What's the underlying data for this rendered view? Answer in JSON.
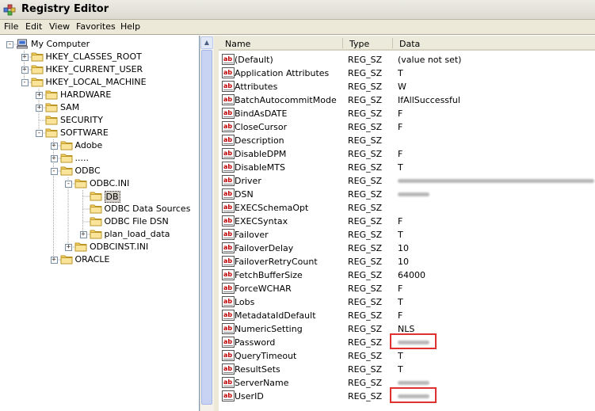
{
  "window": {
    "title": "Registry Editor"
  },
  "menu": [
    "File",
    "Edit",
    "View",
    "Favorites",
    "Help"
  ],
  "tree": [
    {
      "label": "My Computer",
      "level": 0,
      "expander": "-",
      "icon": "computer-icon"
    },
    {
      "label": "HKEY_CLASSES_ROOT",
      "level": 1,
      "expander": "+"
    },
    {
      "label": "HKEY_CURRENT_USER",
      "level": 1,
      "expander": "+"
    },
    {
      "label": "HKEY_LOCAL_MACHINE",
      "level": 1,
      "expander": "-"
    },
    {
      "label": "HARDWARE",
      "level": 2,
      "expander": "+"
    },
    {
      "label": "SAM",
      "level": 2,
      "expander": "+"
    },
    {
      "label": "SECURITY",
      "level": 2,
      "expander": ""
    },
    {
      "label": "SOFTWARE",
      "level": 2,
      "expander": "-"
    },
    {
      "label": "Adobe",
      "level": 3,
      "expander": "+"
    },
    {
      "label": ".....",
      "level": 3,
      "expander": "+"
    },
    {
      "label": "ODBC",
      "level": 3,
      "expander": "-"
    },
    {
      "label": "ODBC.INI",
      "level": 4,
      "expander": "-"
    },
    {
      "label": "DB",
      "level": 5,
      "expander": "",
      "selected": true
    },
    {
      "label": "ODBC Data Sources",
      "level": 5,
      "expander": ""
    },
    {
      "label": "ODBC File DSN",
      "level": 5,
      "expander": ""
    },
    {
      "label": "plan_load_data",
      "level": 5,
      "expander": "+"
    },
    {
      "label": "ODBCINST.INI",
      "level": 4,
      "expander": "+"
    },
    {
      "label": "ORACLE",
      "level": 3,
      "expander": "+"
    }
  ],
  "columns": {
    "name": "Name",
    "type": "Type",
    "data": "Data"
  },
  "values": [
    {
      "name": "(Default)",
      "type": "REG_SZ",
      "data": "(value not set)"
    },
    {
      "name": "Application Attributes",
      "type": "REG_SZ",
      "data": "T"
    },
    {
      "name": "Attributes",
      "type": "REG_SZ",
      "data": "W"
    },
    {
      "name": "BatchAutocommitMode",
      "type": "REG_SZ",
      "data": "IfAllSuccessful"
    },
    {
      "name": "BindAsDATE",
      "type": "REG_SZ",
      "data": "F"
    },
    {
      "name": "CloseCursor",
      "type": "REG_SZ",
      "data": "F"
    },
    {
      "name": "Description",
      "type": "REG_SZ",
      "data": ""
    },
    {
      "name": "DisableDPM",
      "type": "REG_SZ",
      "data": "F"
    },
    {
      "name": "DisableMTS",
      "type": "REG_SZ",
      "data": "T"
    },
    {
      "name": "Driver",
      "type": "REG_SZ",
      "data": "",
      "redacted": "long"
    },
    {
      "name": "DSN",
      "type": "REG_SZ",
      "data": "",
      "redacted": "short"
    },
    {
      "name": "EXECSchemaOpt",
      "type": "REG_SZ",
      "data": ""
    },
    {
      "name": "EXECSyntax",
      "type": "REG_SZ",
      "data": "F"
    },
    {
      "name": "Failover",
      "type": "REG_SZ",
      "data": "T"
    },
    {
      "name": "FailoverDelay",
      "type": "REG_SZ",
      "data": "10"
    },
    {
      "name": "FailoverRetryCount",
      "type": "REG_SZ",
      "data": "10"
    },
    {
      "name": "FetchBufferSize",
      "type": "REG_SZ",
      "data": "64000"
    },
    {
      "name": "ForceWCHAR",
      "type": "REG_SZ",
      "data": "F"
    },
    {
      "name": "Lobs",
      "type": "REG_SZ",
      "data": "T"
    },
    {
      "name": "MetadataIdDefault",
      "type": "REG_SZ",
      "data": "F"
    },
    {
      "name": "NumericSetting",
      "type": "REG_SZ",
      "data": "NLS"
    },
    {
      "name": "Password",
      "type": "REG_SZ",
      "data": "",
      "redacted": "short",
      "highlight": true
    },
    {
      "name": "QueryTimeout",
      "type": "REG_SZ",
      "data": "T"
    },
    {
      "name": "ResultSets",
      "type": "REG_SZ",
      "data": "T"
    },
    {
      "name": "ServerName",
      "type": "REG_SZ",
      "data": "",
      "redacted": "short"
    },
    {
      "name": "UserID",
      "type": "REG_SZ",
      "data": "",
      "redacted": "short",
      "highlight": true
    }
  ]
}
